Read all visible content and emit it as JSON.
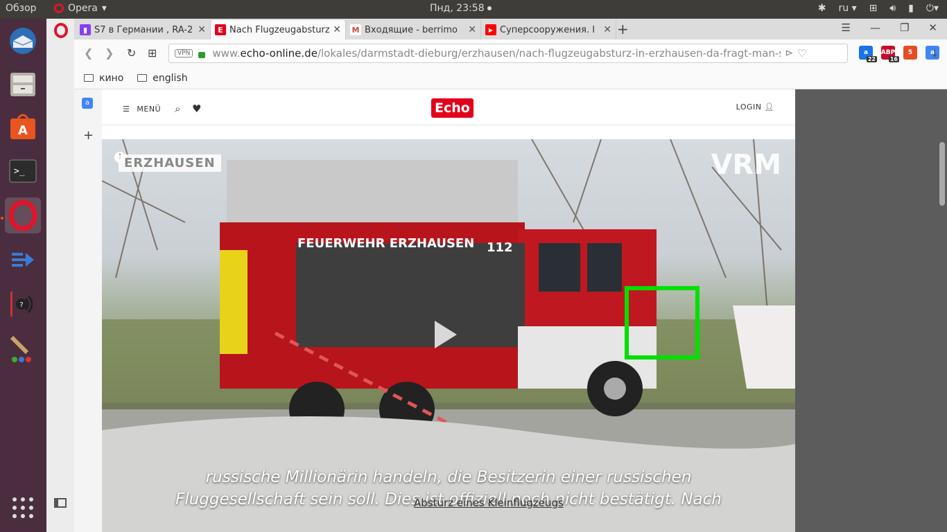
{
  "top_panel": {
    "activities": "Обзор",
    "app_name": "Opera",
    "clock": "Пнд, 23:58",
    "language": "ru"
  },
  "tabs": [
    {
      "title": "S7 в Германии , RA-2",
      "favicon_color": "#8a3df2",
      "favicon_letter": "S"
    },
    {
      "title": "Nach Flugzeugabsturz",
      "favicon_color": "#e2001a",
      "favicon_letter": "E"
    },
    {
      "title": "Входящие - berrimo",
      "favicon_color": "#ffffff",
      "favicon_letter": "M"
    },
    {
      "title": "Суперсооружения. I",
      "favicon_color": "#ff0000",
      "favicon_letter": "▶"
    }
  ],
  "address_bar": {
    "vpn_label": "VPN",
    "url_prefix": "www.",
    "url_domain": "echo-online.de",
    "url_path": "/lokales/darmstadt-dieburg/erzhausen/nach-flugzeugabsturz-in-erzhausen-da-fragt-man-sich-c"
  },
  "extensions": [
    {
      "name": "translate-icon",
      "color": "#1a73e8",
      "badge": "22"
    },
    {
      "name": "abp-icon",
      "color": "#c70d2c",
      "badge": "16"
    },
    {
      "name": "html5-icon",
      "color": "#e44d26",
      "badge": ""
    },
    {
      "name": "translate-icon-2",
      "color": "#4285f4",
      "badge": ""
    }
  ],
  "bookmarks": [
    "кино",
    "english"
  ],
  "site": {
    "menu_label": "MENÜ",
    "logo": "Echo",
    "login_label": "LOGIN"
  },
  "video": {
    "location_tag": "ERZHAUSEN",
    "brand": "VRM",
    "subtitle_line1": "russische Millionärin handeln, die Besitzerin einer russischen",
    "subtitle_line2": "Fluggesellschaft sein soll. Dies ist offiziell noch nicht bestätigt. Nach",
    "caption": "Absturz eines Kleinflugzeugs",
    "truck_text": "FEUERWEHR ERZHAUSEN",
    "truck_number": "112"
  },
  "colors": {
    "accent_echo": "#e2001a",
    "highlight": "#00e000"
  }
}
